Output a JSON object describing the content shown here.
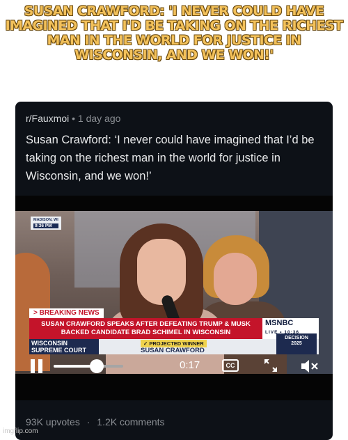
{
  "meme": {
    "caption": "SUSAN CRAWFORD: 'I NEVER COULD HAVE IMAGINED THAT I'D BE TAKING ON THE RICHEST MAN IN THE WORLD FOR JUSTICE IN WISCONSIN, AND WE WON!'"
  },
  "post": {
    "subreddit": "r/Fauxmoi",
    "separator": "•",
    "age": "1 day ago",
    "title": "Susan Crawford: ‘I never could have imagined that I’d be taking on the richest man in the world for justice in Wisconsin, and we won!’",
    "upvotes": "93K upvotes",
    "dot": "·",
    "comments": "1.2K comments"
  },
  "video": {
    "location_line1": "MADISON, WI",
    "location_time": "9:36 PM",
    "breaking_label": "> BREAKING NEWS",
    "headline": "SUSAN CRAWFORD SPEAKS AFTER DEFEATING TRUMP & MUSK\nBACKED CANDIDATE BRAD SCHIMEL IN WISCONSIN",
    "network": "MSNBC",
    "live": "LIVE  •  10:36",
    "state_label": "WISCONSIN\nSUPREME COURT",
    "projected": "✓ PROJECTED WINNER",
    "candidate": "SUSAN CRAWFORD",
    "decision": "DECISION\n2025",
    "time_elapsed": "0:17",
    "cc_label": "CC",
    "progress": 0.62
  },
  "watermark": "imgflip.com"
}
